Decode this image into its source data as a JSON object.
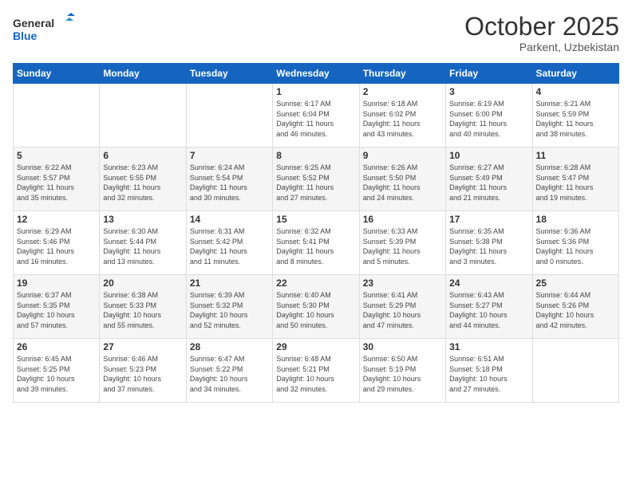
{
  "logo": {
    "line1": "General",
    "line2": "Blue"
  },
  "header": {
    "month": "October 2025",
    "location": "Parkent, Uzbekistan"
  },
  "weekdays": [
    "Sunday",
    "Monday",
    "Tuesday",
    "Wednesday",
    "Thursday",
    "Friday",
    "Saturday"
  ],
  "weeks": [
    [
      {
        "day": "",
        "info": ""
      },
      {
        "day": "",
        "info": ""
      },
      {
        "day": "",
        "info": ""
      },
      {
        "day": "1",
        "info": "Sunrise: 6:17 AM\nSunset: 6:04 PM\nDaylight: 11 hours\nand 46 minutes."
      },
      {
        "day": "2",
        "info": "Sunrise: 6:18 AM\nSunset: 6:02 PM\nDaylight: 11 hours\nand 43 minutes."
      },
      {
        "day": "3",
        "info": "Sunrise: 6:19 AM\nSunset: 6:00 PM\nDaylight: 11 hours\nand 40 minutes."
      },
      {
        "day": "4",
        "info": "Sunrise: 6:21 AM\nSunset: 5:59 PM\nDaylight: 11 hours\nand 38 minutes."
      }
    ],
    [
      {
        "day": "5",
        "info": "Sunrise: 6:22 AM\nSunset: 5:57 PM\nDaylight: 11 hours\nand 35 minutes."
      },
      {
        "day": "6",
        "info": "Sunrise: 6:23 AM\nSunset: 5:55 PM\nDaylight: 11 hours\nand 32 minutes."
      },
      {
        "day": "7",
        "info": "Sunrise: 6:24 AM\nSunset: 5:54 PM\nDaylight: 11 hours\nand 30 minutes."
      },
      {
        "day": "8",
        "info": "Sunrise: 6:25 AM\nSunset: 5:52 PM\nDaylight: 11 hours\nand 27 minutes."
      },
      {
        "day": "9",
        "info": "Sunrise: 6:26 AM\nSunset: 5:50 PM\nDaylight: 11 hours\nand 24 minutes."
      },
      {
        "day": "10",
        "info": "Sunrise: 6:27 AM\nSunset: 5:49 PM\nDaylight: 11 hours\nand 21 minutes."
      },
      {
        "day": "11",
        "info": "Sunrise: 6:28 AM\nSunset: 5:47 PM\nDaylight: 11 hours\nand 19 minutes."
      }
    ],
    [
      {
        "day": "12",
        "info": "Sunrise: 6:29 AM\nSunset: 5:46 PM\nDaylight: 11 hours\nand 16 minutes."
      },
      {
        "day": "13",
        "info": "Sunrise: 6:30 AM\nSunset: 5:44 PM\nDaylight: 11 hours\nand 13 minutes."
      },
      {
        "day": "14",
        "info": "Sunrise: 6:31 AM\nSunset: 5:42 PM\nDaylight: 11 hours\nand 11 minutes."
      },
      {
        "day": "15",
        "info": "Sunrise: 6:32 AM\nSunset: 5:41 PM\nDaylight: 11 hours\nand 8 minutes."
      },
      {
        "day": "16",
        "info": "Sunrise: 6:33 AM\nSunset: 5:39 PM\nDaylight: 11 hours\nand 5 minutes."
      },
      {
        "day": "17",
        "info": "Sunrise: 6:35 AM\nSunset: 5:38 PM\nDaylight: 11 hours\nand 3 minutes."
      },
      {
        "day": "18",
        "info": "Sunrise: 6:36 AM\nSunset: 5:36 PM\nDaylight: 11 hours\nand 0 minutes."
      }
    ],
    [
      {
        "day": "19",
        "info": "Sunrise: 6:37 AM\nSunset: 5:35 PM\nDaylight: 10 hours\nand 57 minutes."
      },
      {
        "day": "20",
        "info": "Sunrise: 6:38 AM\nSunset: 5:33 PM\nDaylight: 10 hours\nand 55 minutes."
      },
      {
        "day": "21",
        "info": "Sunrise: 6:39 AM\nSunset: 5:32 PM\nDaylight: 10 hours\nand 52 minutes."
      },
      {
        "day": "22",
        "info": "Sunrise: 6:40 AM\nSunset: 5:30 PM\nDaylight: 10 hours\nand 50 minutes."
      },
      {
        "day": "23",
        "info": "Sunrise: 6:41 AM\nSunset: 5:29 PM\nDaylight: 10 hours\nand 47 minutes."
      },
      {
        "day": "24",
        "info": "Sunrise: 6:43 AM\nSunset: 5:27 PM\nDaylight: 10 hours\nand 44 minutes."
      },
      {
        "day": "25",
        "info": "Sunrise: 6:44 AM\nSunset: 5:26 PM\nDaylight: 10 hours\nand 42 minutes."
      }
    ],
    [
      {
        "day": "26",
        "info": "Sunrise: 6:45 AM\nSunset: 5:25 PM\nDaylight: 10 hours\nand 39 minutes."
      },
      {
        "day": "27",
        "info": "Sunrise: 6:46 AM\nSunset: 5:23 PM\nDaylight: 10 hours\nand 37 minutes."
      },
      {
        "day": "28",
        "info": "Sunrise: 6:47 AM\nSunset: 5:22 PM\nDaylight: 10 hours\nand 34 minutes."
      },
      {
        "day": "29",
        "info": "Sunrise: 6:48 AM\nSunset: 5:21 PM\nDaylight: 10 hours\nand 32 minutes."
      },
      {
        "day": "30",
        "info": "Sunrise: 6:50 AM\nSunset: 5:19 PM\nDaylight: 10 hours\nand 29 minutes."
      },
      {
        "day": "31",
        "info": "Sunrise: 6:51 AM\nSunset: 5:18 PM\nDaylight: 10 hours\nand 27 minutes."
      },
      {
        "day": "",
        "info": ""
      }
    ]
  ]
}
